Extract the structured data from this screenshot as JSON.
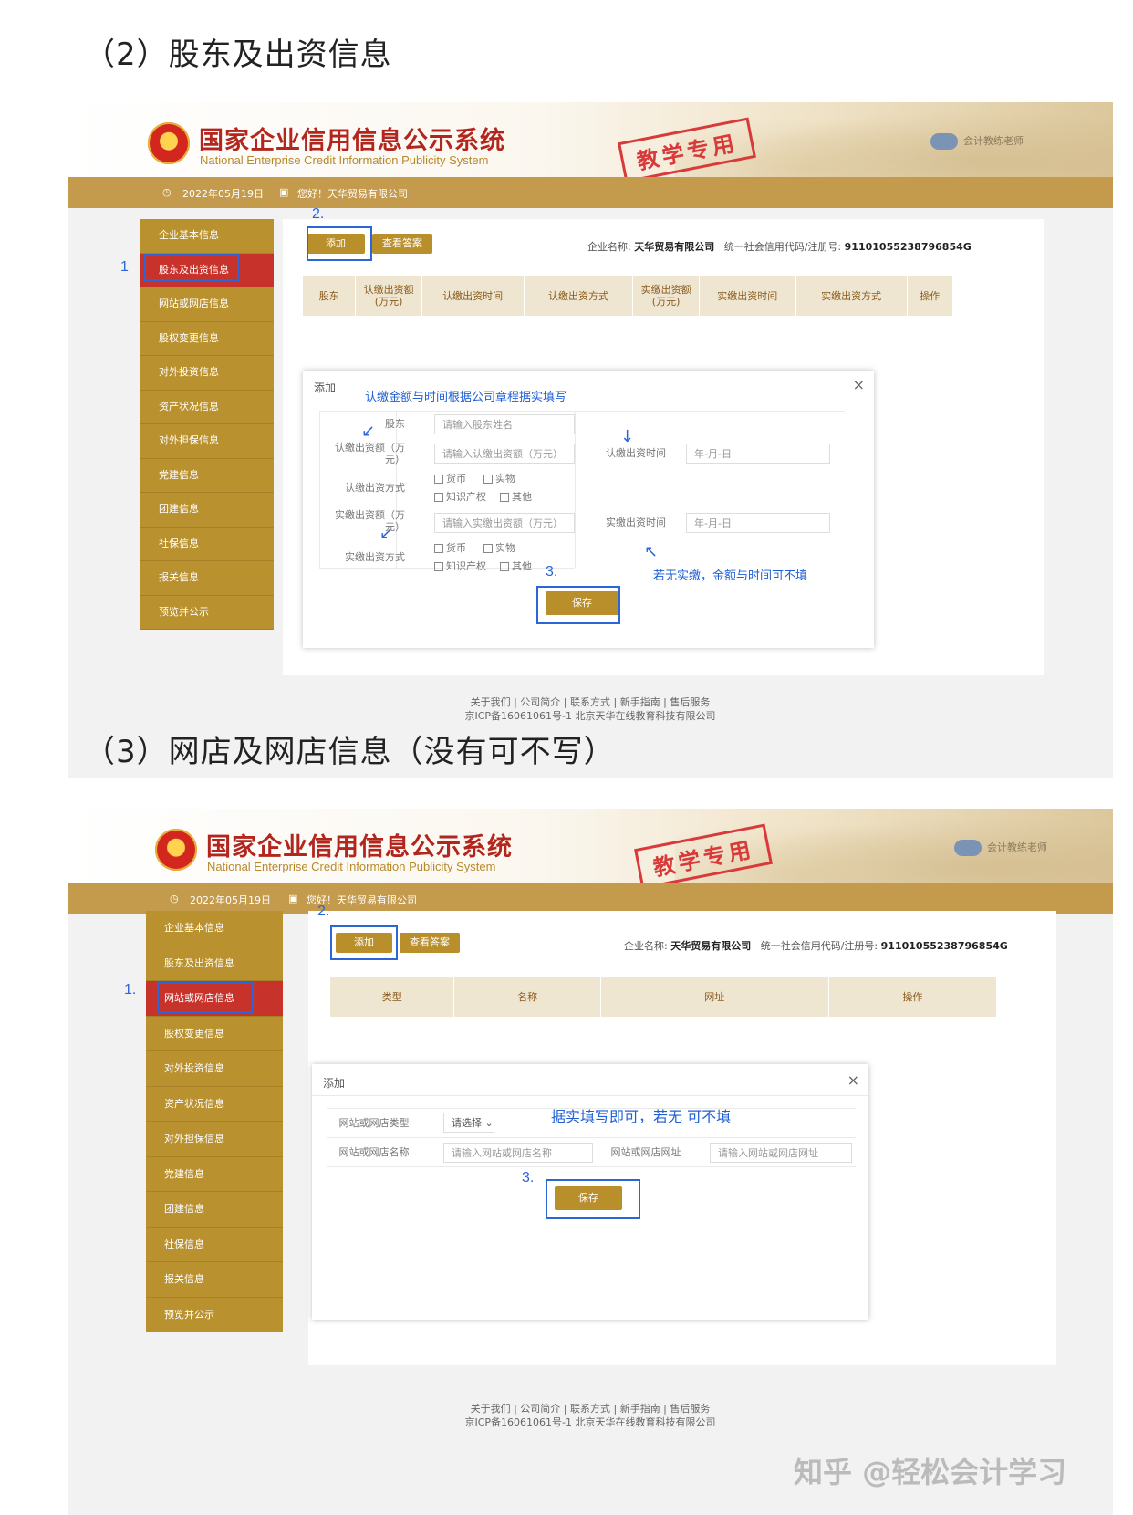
{
  "sections": [
    {
      "heading": "（2）股东及出资信息",
      "app": {
        "logo_cn": "国家企业信用信息公示系统",
        "logo_en": "National Enterprise Credit Information Publicity System",
        "stamp": "教学专用",
        "user": "会计教练老师",
        "date": "2022年05月19日",
        "greeting": "您好！天华贸易有限公司"
      },
      "sidebar": [
        "企业基本信息",
        "股东及出资信息",
        "网站或网店信息",
        "股权变更信息",
        "对外投资信息",
        "资产状况信息",
        "对外担保信息",
        "党建信息",
        "团建信息",
        "社保信息",
        "报关信息",
        "预览并公示"
      ],
      "active_item": "股东及出资信息",
      "buttons": {
        "add": "添加",
        "answer": "查看答案"
      },
      "company_label": "企业名称:",
      "company_name": "天华贸易有限公司",
      "credit_label": "统一社会信用代码/注册号:",
      "credit_code": "91101055238796854G",
      "table_headers": [
        "股东",
        "认缴出资额\n(万元)",
        "认缴出资时间",
        "认缴出资方式",
        "实缴出资额\n(万元)",
        "实缴出资时间",
        "实缴出资方式",
        "操作"
      ],
      "modal": {
        "title": "添加",
        "close": "×",
        "note": "认缴金额与时间根据公司章程据实填写",
        "note2": "若无实缴，金额与时间可不填",
        "shareholder_label": "股东",
        "shareholder_ph": "请输入股东姓名",
        "sub_amount_label": "认缴出资额（万元）",
        "sub_amount_ph": "请输入认缴出资额（万元）",
        "sub_time_label": "认缴出资时间",
        "sub_time_ph": "年-月-日",
        "sub_method_label": "认缴出资方式",
        "paid_amount_label": "实缴出资额（万元）",
        "paid_amount_ph": "请输入实缴出资额（万元）",
        "paid_time_label": "实缴出资时间",
        "paid_time_ph": "年-月-日",
        "paid_method_label": "实缴出资方式",
        "methods": [
          "货币",
          "实物",
          "知识产权",
          "其他"
        ],
        "save": "保存"
      },
      "annotations": [
        "1",
        "2.",
        "3."
      ],
      "footer_links": "关于我们 | 公司简介 | 联系方式 | 新手指南 | 售后服务",
      "footer_icp": "京ICP备16061061号-1 北京天华在线教育科技有限公司"
    },
    {
      "heading": "（3）网店及网店信息（没有可不写）",
      "app": {
        "logo_cn": "国家企业信用信息公示系统",
        "logo_en": "National Enterprise Credit Information Publicity System",
        "stamp": "教学专用",
        "user": "会计教练老师",
        "date": "2022年05月19日",
        "greeting": "您好！天华贸易有限公司"
      },
      "sidebar": [
        "企业基本信息",
        "股东及出资信息",
        "网站或网店信息",
        "股权变更信息",
        "对外投资信息",
        "资产状况信息",
        "对外担保信息",
        "党建信息",
        "团建信息",
        "社保信息",
        "报关信息",
        "预览并公示"
      ],
      "active_item": "网站或网店信息",
      "buttons": {
        "add": "添加",
        "answer": "查看答案"
      },
      "company_label": "企业名称:",
      "company_name": "天华贸易有限公司",
      "credit_label": "统一社会信用代码/注册号:",
      "credit_code": "91101055238796854G",
      "table_headers": [
        "类型",
        "名称",
        "网址",
        "操作"
      ],
      "modal": {
        "title": "添加",
        "close": "×",
        "note": "据实填写即可，若无 可不填",
        "type_label": "网站或网店类型",
        "type_value": "请选择",
        "name_label": "网站或网店名称",
        "name_ph": "请输入网站或网店名称",
        "url_label": "网站或网店网址",
        "url_ph": "请输入网站或网店网址",
        "save": "保存"
      },
      "annotations": [
        "1.",
        "2.",
        "3."
      ],
      "footer_links": "关于我们 | 公司简介 | 联系方式 | 新手指南 | 售后服务",
      "footer_icp": "京ICP备16061061号-1 北京天华在线教育科技有限公司"
    }
  ],
  "watermark": "知乎 @轻松会计学习",
  "colors": {
    "gold": "#b9912e",
    "active_red": "#c7322b",
    "annotation_blue": "#2b66d9"
  }
}
